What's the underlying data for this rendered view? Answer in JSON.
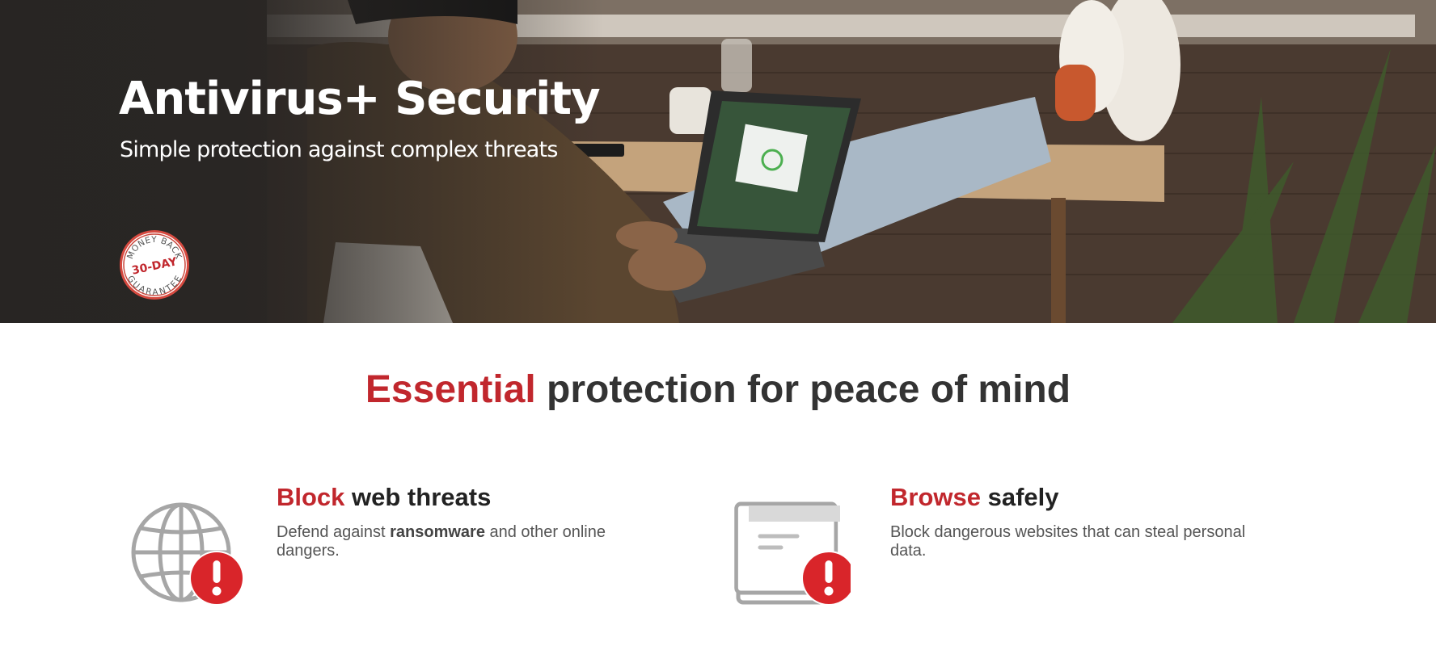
{
  "hero": {
    "title": "Antivirus+ Security",
    "subtitle": "Simple protection against complex threats",
    "badge": {
      "top_text": "MONEY BACK",
      "middle_text": "30-DAY",
      "bottom_text": "GUARANTEE"
    }
  },
  "main": {
    "headline_accent": "Essential",
    "headline_rest": " protection for peace of mind",
    "features": [
      {
        "icon": "globe-alert-icon",
        "title_accent": "Block",
        "title_rest": " web threats",
        "desc_before": "Defend against ",
        "desc_bold": "ransomware",
        "desc_after": " and other online dangers."
      },
      {
        "icon": "browser-alert-icon",
        "title_accent": "Browse",
        "title_rest": " safely",
        "desc": "Block dangerous websites that can steal personal data."
      }
    ]
  },
  "colors": {
    "accent": "#c1272d",
    "icon_gray": "#a6a6a6",
    "alert_red": "#d9252a",
    "hero_dark": "#2e2a27"
  }
}
